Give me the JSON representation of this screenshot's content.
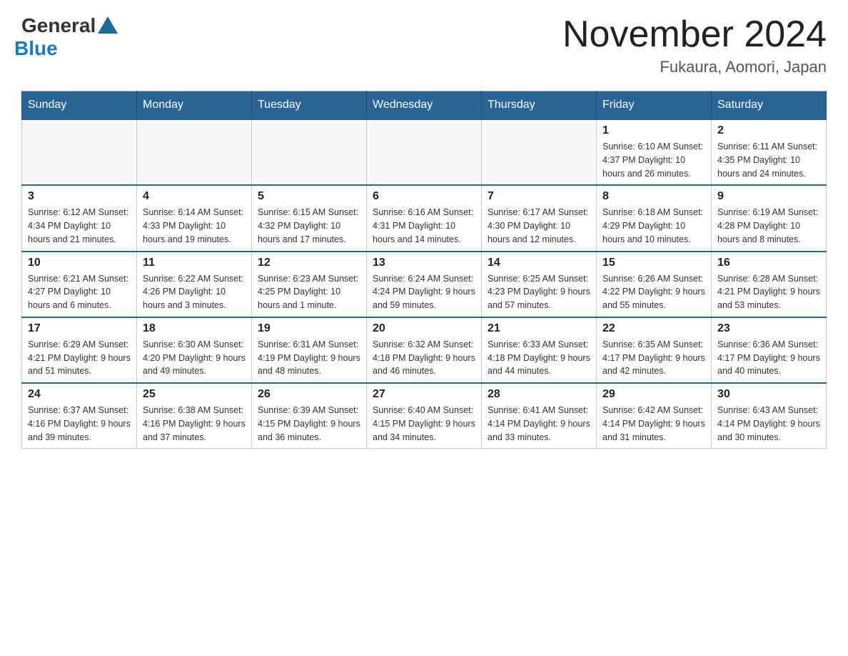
{
  "header": {
    "logo_general": "General",
    "logo_blue": "Blue",
    "title": "November 2024",
    "subtitle": "Fukaura, Aomori, Japan"
  },
  "weekdays": [
    "Sunday",
    "Monday",
    "Tuesday",
    "Wednesday",
    "Thursday",
    "Friday",
    "Saturday"
  ],
  "weeks": [
    [
      {
        "day": "",
        "info": ""
      },
      {
        "day": "",
        "info": ""
      },
      {
        "day": "",
        "info": ""
      },
      {
        "day": "",
        "info": ""
      },
      {
        "day": "",
        "info": ""
      },
      {
        "day": "1",
        "info": "Sunrise: 6:10 AM\nSunset: 4:37 PM\nDaylight: 10 hours\nand 26 minutes."
      },
      {
        "day": "2",
        "info": "Sunrise: 6:11 AM\nSunset: 4:35 PM\nDaylight: 10 hours\nand 24 minutes."
      }
    ],
    [
      {
        "day": "3",
        "info": "Sunrise: 6:12 AM\nSunset: 4:34 PM\nDaylight: 10 hours\nand 21 minutes."
      },
      {
        "day": "4",
        "info": "Sunrise: 6:14 AM\nSunset: 4:33 PM\nDaylight: 10 hours\nand 19 minutes."
      },
      {
        "day": "5",
        "info": "Sunrise: 6:15 AM\nSunset: 4:32 PM\nDaylight: 10 hours\nand 17 minutes."
      },
      {
        "day": "6",
        "info": "Sunrise: 6:16 AM\nSunset: 4:31 PM\nDaylight: 10 hours\nand 14 minutes."
      },
      {
        "day": "7",
        "info": "Sunrise: 6:17 AM\nSunset: 4:30 PM\nDaylight: 10 hours\nand 12 minutes."
      },
      {
        "day": "8",
        "info": "Sunrise: 6:18 AM\nSunset: 4:29 PM\nDaylight: 10 hours\nand 10 minutes."
      },
      {
        "day": "9",
        "info": "Sunrise: 6:19 AM\nSunset: 4:28 PM\nDaylight: 10 hours\nand 8 minutes."
      }
    ],
    [
      {
        "day": "10",
        "info": "Sunrise: 6:21 AM\nSunset: 4:27 PM\nDaylight: 10 hours\nand 6 minutes."
      },
      {
        "day": "11",
        "info": "Sunrise: 6:22 AM\nSunset: 4:26 PM\nDaylight: 10 hours\nand 3 minutes."
      },
      {
        "day": "12",
        "info": "Sunrise: 6:23 AM\nSunset: 4:25 PM\nDaylight: 10 hours\nand 1 minute."
      },
      {
        "day": "13",
        "info": "Sunrise: 6:24 AM\nSunset: 4:24 PM\nDaylight: 9 hours\nand 59 minutes."
      },
      {
        "day": "14",
        "info": "Sunrise: 6:25 AM\nSunset: 4:23 PM\nDaylight: 9 hours\nand 57 minutes."
      },
      {
        "day": "15",
        "info": "Sunrise: 6:26 AM\nSunset: 4:22 PM\nDaylight: 9 hours\nand 55 minutes."
      },
      {
        "day": "16",
        "info": "Sunrise: 6:28 AM\nSunset: 4:21 PM\nDaylight: 9 hours\nand 53 minutes."
      }
    ],
    [
      {
        "day": "17",
        "info": "Sunrise: 6:29 AM\nSunset: 4:21 PM\nDaylight: 9 hours\nand 51 minutes."
      },
      {
        "day": "18",
        "info": "Sunrise: 6:30 AM\nSunset: 4:20 PM\nDaylight: 9 hours\nand 49 minutes."
      },
      {
        "day": "19",
        "info": "Sunrise: 6:31 AM\nSunset: 4:19 PM\nDaylight: 9 hours\nand 48 minutes."
      },
      {
        "day": "20",
        "info": "Sunrise: 6:32 AM\nSunset: 4:18 PM\nDaylight: 9 hours\nand 46 minutes."
      },
      {
        "day": "21",
        "info": "Sunrise: 6:33 AM\nSunset: 4:18 PM\nDaylight: 9 hours\nand 44 minutes."
      },
      {
        "day": "22",
        "info": "Sunrise: 6:35 AM\nSunset: 4:17 PM\nDaylight: 9 hours\nand 42 minutes."
      },
      {
        "day": "23",
        "info": "Sunrise: 6:36 AM\nSunset: 4:17 PM\nDaylight: 9 hours\nand 40 minutes."
      }
    ],
    [
      {
        "day": "24",
        "info": "Sunrise: 6:37 AM\nSunset: 4:16 PM\nDaylight: 9 hours\nand 39 minutes."
      },
      {
        "day": "25",
        "info": "Sunrise: 6:38 AM\nSunset: 4:16 PM\nDaylight: 9 hours\nand 37 minutes."
      },
      {
        "day": "26",
        "info": "Sunrise: 6:39 AM\nSunset: 4:15 PM\nDaylight: 9 hours\nand 36 minutes."
      },
      {
        "day": "27",
        "info": "Sunrise: 6:40 AM\nSunset: 4:15 PM\nDaylight: 9 hours\nand 34 minutes."
      },
      {
        "day": "28",
        "info": "Sunrise: 6:41 AM\nSunset: 4:14 PM\nDaylight: 9 hours\nand 33 minutes."
      },
      {
        "day": "29",
        "info": "Sunrise: 6:42 AM\nSunset: 4:14 PM\nDaylight: 9 hours\nand 31 minutes."
      },
      {
        "day": "30",
        "info": "Sunrise: 6:43 AM\nSunset: 4:14 PM\nDaylight: 9 hours\nand 30 minutes."
      }
    ]
  ]
}
